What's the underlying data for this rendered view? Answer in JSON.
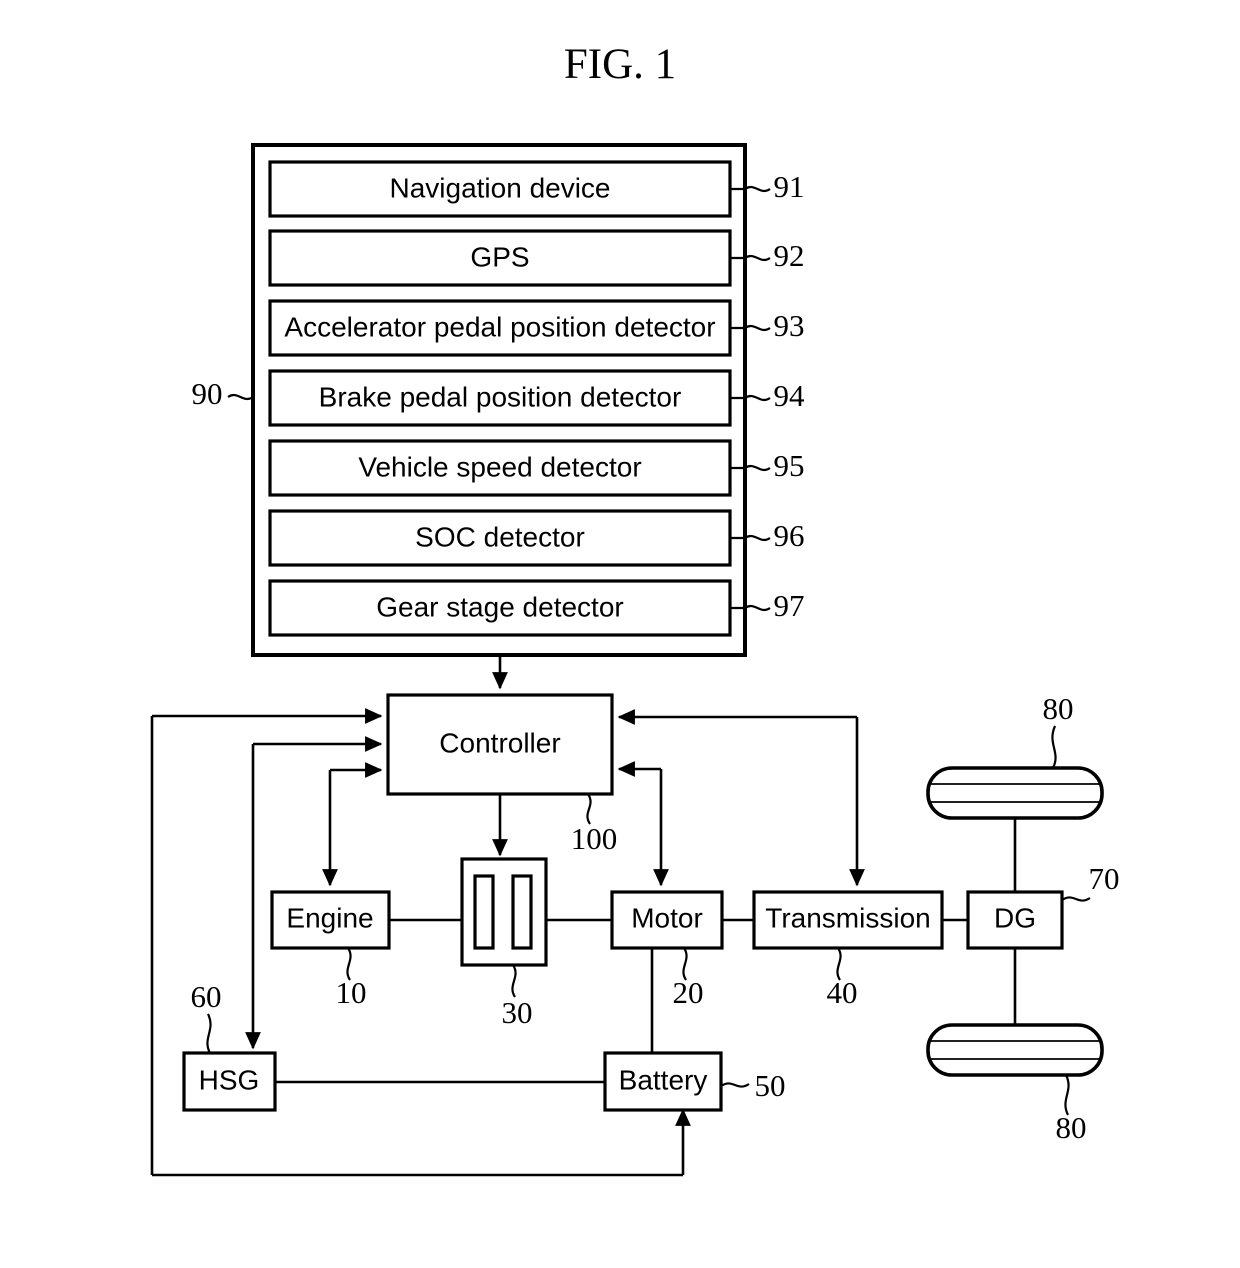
{
  "figure": {
    "title": "FIG. 1",
    "domain_note": "patent block diagram of a hybrid vehicle powertrain control system"
  },
  "sensor_group": {
    "ref": "90",
    "items": [
      {
        "label": "Navigation device",
        "ref": "91"
      },
      {
        "label": "GPS",
        "ref": "92"
      },
      {
        "label": "Accelerator pedal position detector",
        "ref": "93"
      },
      {
        "label": "Brake pedal position detector",
        "ref": "94"
      },
      {
        "label": "Vehicle speed detector",
        "ref": "95"
      },
      {
        "label": "SOC detector",
        "ref": "96"
      },
      {
        "label": "Gear stage detector",
        "ref": "97"
      }
    ]
  },
  "controller": {
    "label": "Controller",
    "ref": "100"
  },
  "powertrain": {
    "engine": {
      "label": "Engine",
      "ref": "10"
    },
    "clutch": {
      "label": "",
      "ref": "30"
    },
    "motor": {
      "label": "Motor",
      "ref": "20"
    },
    "transmission": {
      "label": "Transmission",
      "ref": "40"
    },
    "differential": {
      "label": "DG",
      "ref": "70"
    },
    "hsg": {
      "label": "HSG",
      "ref": "60"
    },
    "battery": {
      "label": "Battery",
      "ref": "50"
    },
    "wheel_top": {
      "label": "",
      "ref": "80"
    },
    "wheel_bottom": {
      "label": "",
      "ref": "80"
    }
  },
  "style": {
    "ink": "#000000",
    "paper": "#ffffff"
  }
}
